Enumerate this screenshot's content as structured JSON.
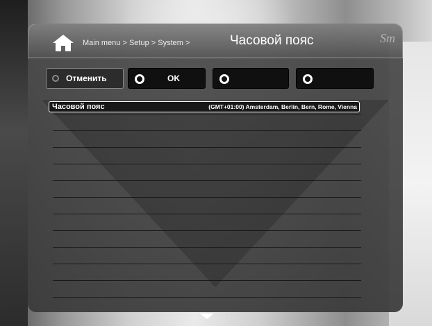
{
  "header": {
    "breadcrumb": "Main menu > Setup > System >",
    "title": "Часовой пояс",
    "brand": "Sm"
  },
  "buttons": [
    {
      "label": "Отменить",
      "color": "#888888"
    },
    {
      "label": "OK",
      "color": "#ffffff"
    },
    {
      "label": "",
      "color": "#ffffff"
    },
    {
      "label": "",
      "color": "#ffffff"
    }
  ],
  "settings": {
    "rows": [
      {
        "name": "Часовой пояс",
        "value": "(GMT+01:00) Amsterdam, Berlin, Bern, Rome, Vienna",
        "selected": true
      }
    ]
  }
}
